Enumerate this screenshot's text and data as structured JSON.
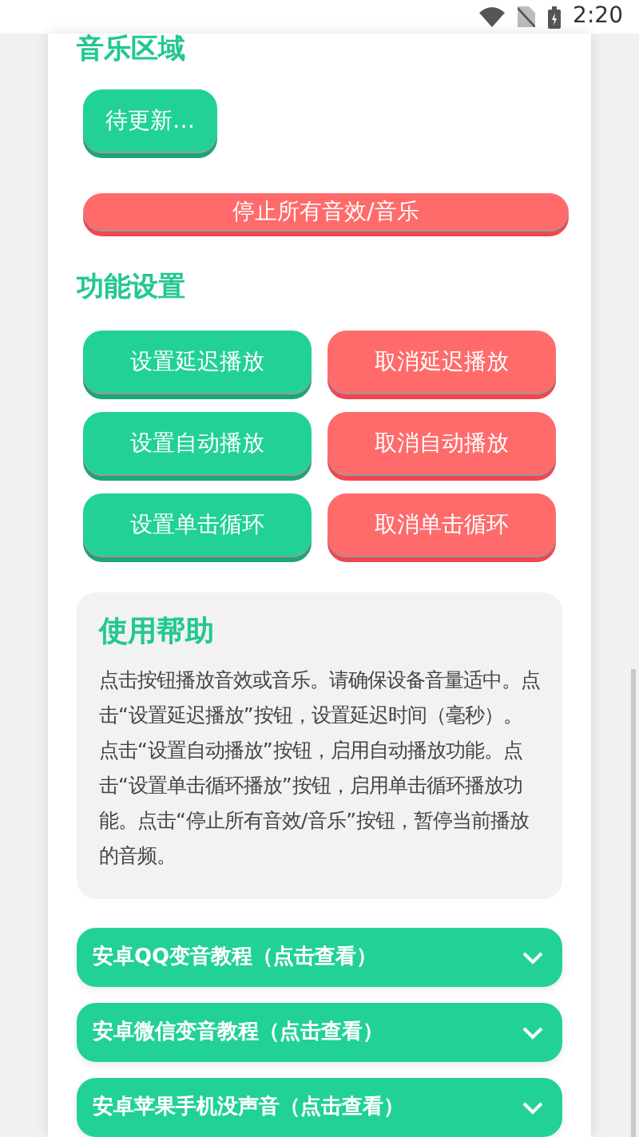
{
  "status_bar": {
    "time": "2:20"
  },
  "music_section": {
    "title": "音乐区域",
    "buttons": [
      {
        "label": "待更新…",
        "kind": "set"
      }
    ],
    "stop_button": {
      "label": "停止所有音效/音乐",
      "kind": "cancel"
    }
  },
  "settings_section": {
    "title": "功能设置",
    "buttons": [
      {
        "label": "设置延迟播放",
        "kind": "set"
      },
      {
        "label": "取消延迟播放",
        "kind": "cancel"
      },
      {
        "label": "设置自动播放",
        "kind": "set"
      },
      {
        "label": "取消自动播放",
        "kind": "cancel"
      },
      {
        "label": "设置单击循环",
        "kind": "set"
      },
      {
        "label": "取消单击循环",
        "kind": "cancel"
      }
    ]
  },
  "help": {
    "title": "使用帮助",
    "text": "点击按钮播放音效或音乐。请确保设备音量适中。点击“设置延迟播放”按钮，设置延迟时间（毫秒）。点击“设置自动播放”按钮，启用自动播放功能。点击“设置单击循环播放”按钮，启用单击循环播放功能。点击“停止所有音效/音乐”按钮，暂停当前播放的音频。"
  },
  "accordions": [
    {
      "title": "安卓QQ变音教程（点击查看）",
      "expanded": false
    },
    {
      "title": "安卓微信变音教程（点击查看）",
      "expanded": false
    },
    {
      "title": "安卓苹果手机没声音（点击查看）",
      "expanded": false
    }
  ]
}
